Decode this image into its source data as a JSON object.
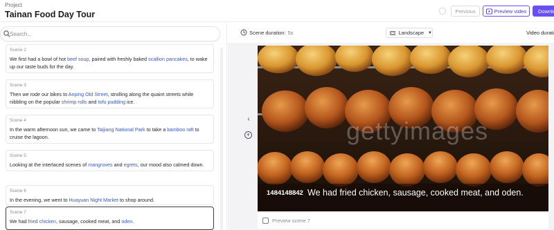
{
  "header": {
    "breadcrumb": "Project",
    "title": "Tainan Food Day Tour",
    "previous_label": "Previous",
    "preview_video_label": "Preview video",
    "download_label": "Download",
    "icons": {
      "preview": "play-icon",
      "download": "download-icon",
      "status": "circle-icon"
    },
    "accent_color": "#6a4ff3"
  },
  "sidebar": {
    "search_placeholder": "Search...",
    "scenes": [
      {
        "label": "Scene 2",
        "parts": [
          {
            "t": "We first had a bowl of hot "
          },
          {
            "t": "beef soup",
            "kw": true
          },
          {
            "t": ", paired with freshly baked "
          },
          {
            "t": "scallion pancakes",
            "kw": true
          },
          {
            "t": ", to wake up our taste buds for the day."
          }
        ]
      },
      {
        "label": "Scene 3",
        "parts": [
          {
            "t": "Then we rode our bikes to "
          },
          {
            "t": "Anping Old Street",
            "kw": true
          },
          {
            "t": ", strolling along the quaint streets while nibbling on the popular "
          },
          {
            "t": "shrimp rolls",
            "kw": true
          },
          {
            "t": " and "
          },
          {
            "t": "tofu pudding",
            "kw": true
          },
          {
            "t": " ice."
          }
        ]
      },
      {
        "label": "Scene 4",
        "parts": [
          {
            "t": "In the warm afternoon sun, we came to "
          },
          {
            "t": "Taijiang National Park",
            "kw": true
          },
          {
            "t": " to take a "
          },
          {
            "t": "bamboo raft",
            "kw": true
          },
          {
            "t": " to cruise the lagoon."
          }
        ]
      },
      {
        "label": "Scene 5",
        "parts": [
          {
            "t": "Looking at the interlaced scenes of "
          },
          {
            "t": "mangroves",
            "kw": true
          },
          {
            "t": " and "
          },
          {
            "t": "egrets",
            "kw": true
          },
          {
            "t": ", our mood also calmed down."
          }
        ]
      },
      {
        "label": "Scene 6",
        "parts": [
          {
            "t": "In the evening, we went to "
          },
          {
            "t": "Huayuan Night Market",
            "kw": true
          },
          {
            "t": " to shop around."
          }
        ]
      },
      {
        "label": "Scene 7",
        "active": true,
        "parts": [
          {
            "t": "We had "
          },
          {
            "t": "fried chicken",
            "kw": true
          },
          {
            "t": ", sausage, cooked meat, and "
          },
          {
            "t": "oden",
            "kw": true
          },
          {
            "t": "."
          }
        ]
      }
    ],
    "keyword_color": "#3b58c4"
  },
  "toolbar": {
    "scene_duration_label": "Scene duration:",
    "scene_duration_value": "5s",
    "orientation_label": "Landscape",
    "video_duration_label": "Video duration"
  },
  "stage": {
    "watermark": "gettyimages",
    "image_id": "1484148842",
    "subtitle_parts": [
      {
        "t": "We had "
      },
      {
        "t": "fried chicken",
        "kw": true
      },
      {
        "t": ", sausage, cooked meat, and "
      },
      {
        "t": "oden",
        "kw": true
      },
      {
        "t": "."
      }
    ],
    "preview_checkbox_label": "Preview scene 7",
    "icons": {
      "prev": "chevron-left-icon",
      "add": "plus-circle-icon"
    }
  }
}
